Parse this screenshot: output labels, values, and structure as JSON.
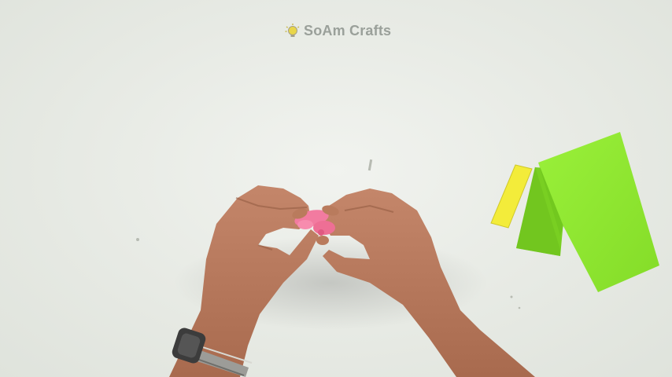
{
  "watermark": {
    "text": "SoAm Crafts",
    "icon": "lightbulb-icon"
  },
  "colors": {
    "background": "#e8ebe6",
    "paper_lime": "#8fe82e",
    "paper_yellow": "#f3ec3a",
    "paper_pink": "#f27ba0",
    "skin": "#b8785a",
    "watermark": "#9aa09a"
  }
}
